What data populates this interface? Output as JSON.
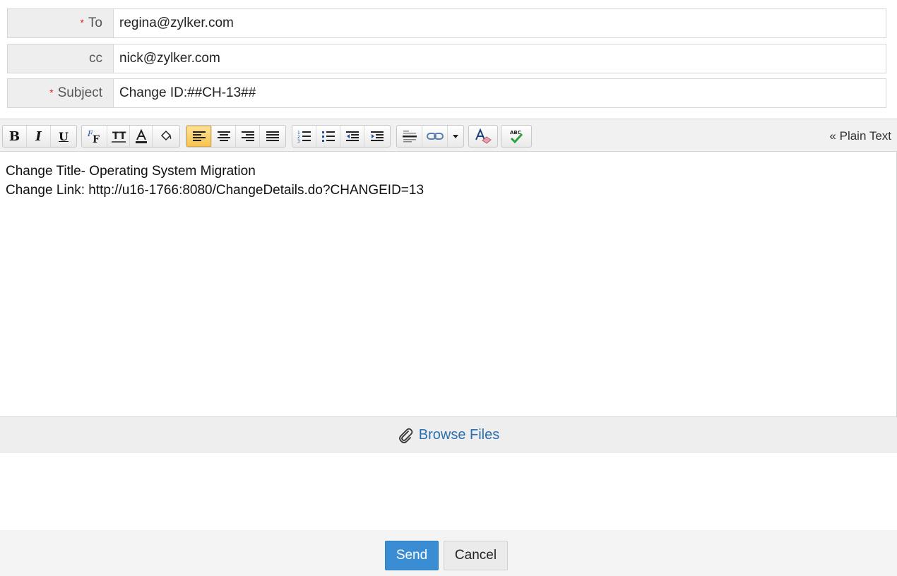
{
  "form": {
    "to": {
      "label": "To",
      "required": true,
      "value": "regina@zylker.com"
    },
    "cc": {
      "label": "cc",
      "required": false,
      "value": "nick@zylker.com"
    },
    "subject": {
      "label": "Subject",
      "required": true,
      "value": "Change ID:##CH-13##"
    },
    "required_marker": "*"
  },
  "toolbar": {
    "plain_text_label": "« Plain Text",
    "buttons": [
      "bold-icon",
      "italic-icon",
      "underline-icon",
      "font-family-icon",
      "font-size-icon",
      "text-color-icon",
      "background-color-icon",
      "align-left-icon",
      "align-center-icon",
      "align-right-icon",
      "align-justify-icon",
      "ordered-list-icon",
      "unordered-list-icon",
      "outdent-icon",
      "indent-icon",
      "horizontal-rule-icon",
      "link-icon",
      "more-dropdown-icon",
      "clear-format-icon",
      "spellcheck-icon"
    ],
    "active_button": "align-left-icon",
    "glyphs": {
      "bold": "B",
      "italic": "I",
      "underline": "U",
      "spellcheck": "ABC"
    }
  },
  "editor": {
    "lines": [
      "Change Title- Operating System Migration",
      "Change Link: http://u16-1766:8080/ChangeDetails.do?CHANGEID=13"
    ]
  },
  "attachments": {
    "browse_label": "Browse Files"
  },
  "actions": {
    "send_label": "Send",
    "cancel_label": "Cancel"
  },
  "colors": {
    "accent": "#3a8dd3",
    "link": "#2a6fb0",
    "required": "#e02020",
    "active_tool": "#f6c34e"
  }
}
